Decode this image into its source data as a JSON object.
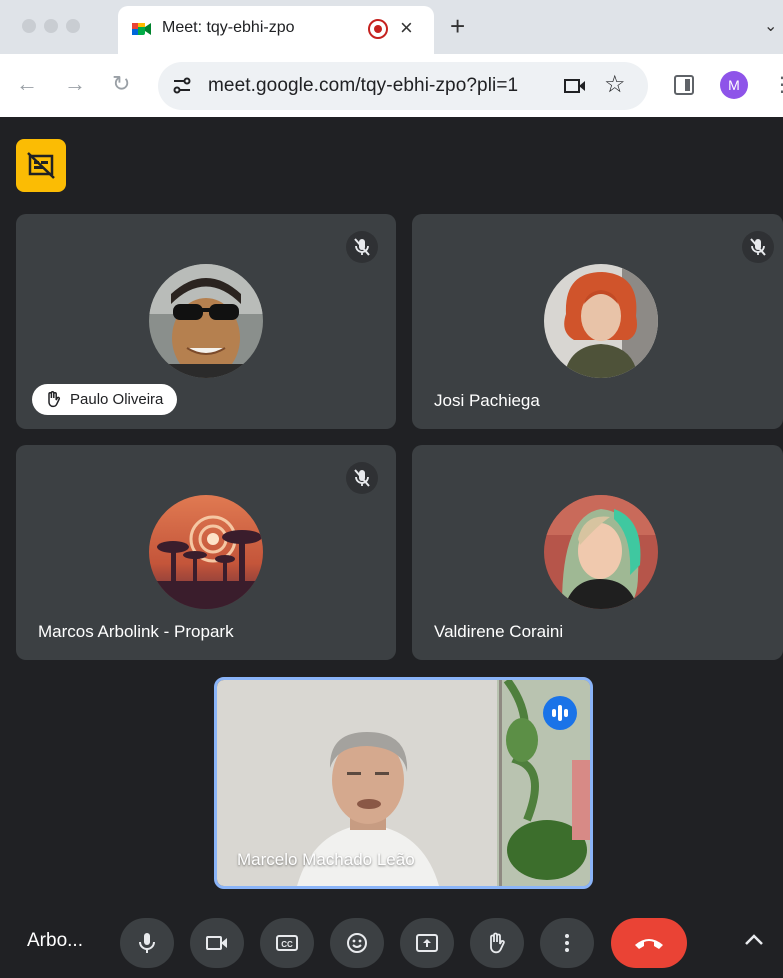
{
  "browser": {
    "tab_title": "Meet: tqy-ebhi-zpo",
    "tab_close": "×",
    "new_tab": "+",
    "url": "meet.google.com/tqy-ebhi-zpo?pli=1",
    "profile_initial": "M"
  },
  "participants": [
    {
      "name": "Paulo Oliveira",
      "muted": true,
      "hand_raised": true
    },
    {
      "name": "Josi Pachiega",
      "muted": true
    },
    {
      "name": "Marcos Arbolink - Propark",
      "muted": true
    },
    {
      "name": "Valdirene Coraini",
      "muted": false
    }
  ],
  "self_view": {
    "name": "Marcelo Machado Leão",
    "speaking": true
  },
  "controls": {
    "meeting_label": "Arbo...",
    "buttons": [
      "mic-icon",
      "camera-icon",
      "captions-icon",
      "emoji-icon",
      "present-icon",
      "raise-hand-icon",
      "more-options-icon",
      "leave-call-icon",
      "chevron-up-icon"
    ]
  },
  "colors": {
    "background": "#202124",
    "tile": "#3c4043",
    "leave": "#ea4335",
    "badge": "#fbbc04",
    "active_speaker": "#1a73e8",
    "self_border": "#8ab4f8"
  }
}
